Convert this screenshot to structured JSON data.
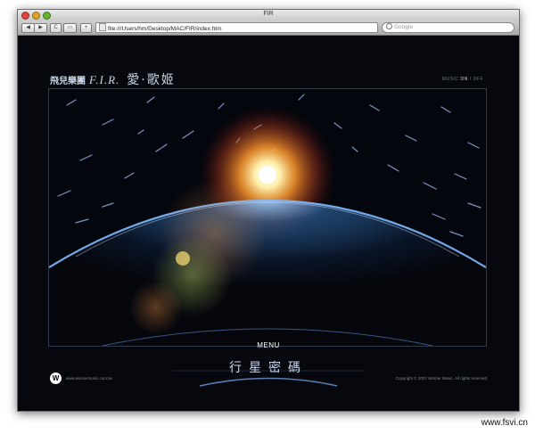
{
  "window": {
    "title": "FIR",
    "url": "file:///Users/hm/Desktop/MAC/FIR/index.htm",
    "search_placeholder": "Google"
  },
  "toolbar": {
    "back_glyph": "◀",
    "forward_glyph": "▶",
    "reload_glyph": "C",
    "tabs_glyph": "▭",
    "newtab_glyph": "+"
  },
  "site": {
    "band_chinese": "飛兒樂團",
    "band_latin": "F.I.R.",
    "album_title": "愛·歌姬",
    "music_label": "MUSIC",
    "music_on": "ON",
    "music_separator": "/",
    "music_off": "OFF",
    "menu_label": "MENU",
    "planet_title": "行星密碼",
    "warner_logo_letter": "W",
    "warner_url": "www.warnermusic.com.tw",
    "copyright": "Copyright © 2007 Warner Music. All rights reserved"
  },
  "watermark": "www.fsvi.cn",
  "colors": {
    "page_background": "#07080d",
    "sun_glow": "#ff8a2a",
    "earth_rim": "#6fb4ff",
    "text_light": "#c9d6ee"
  }
}
